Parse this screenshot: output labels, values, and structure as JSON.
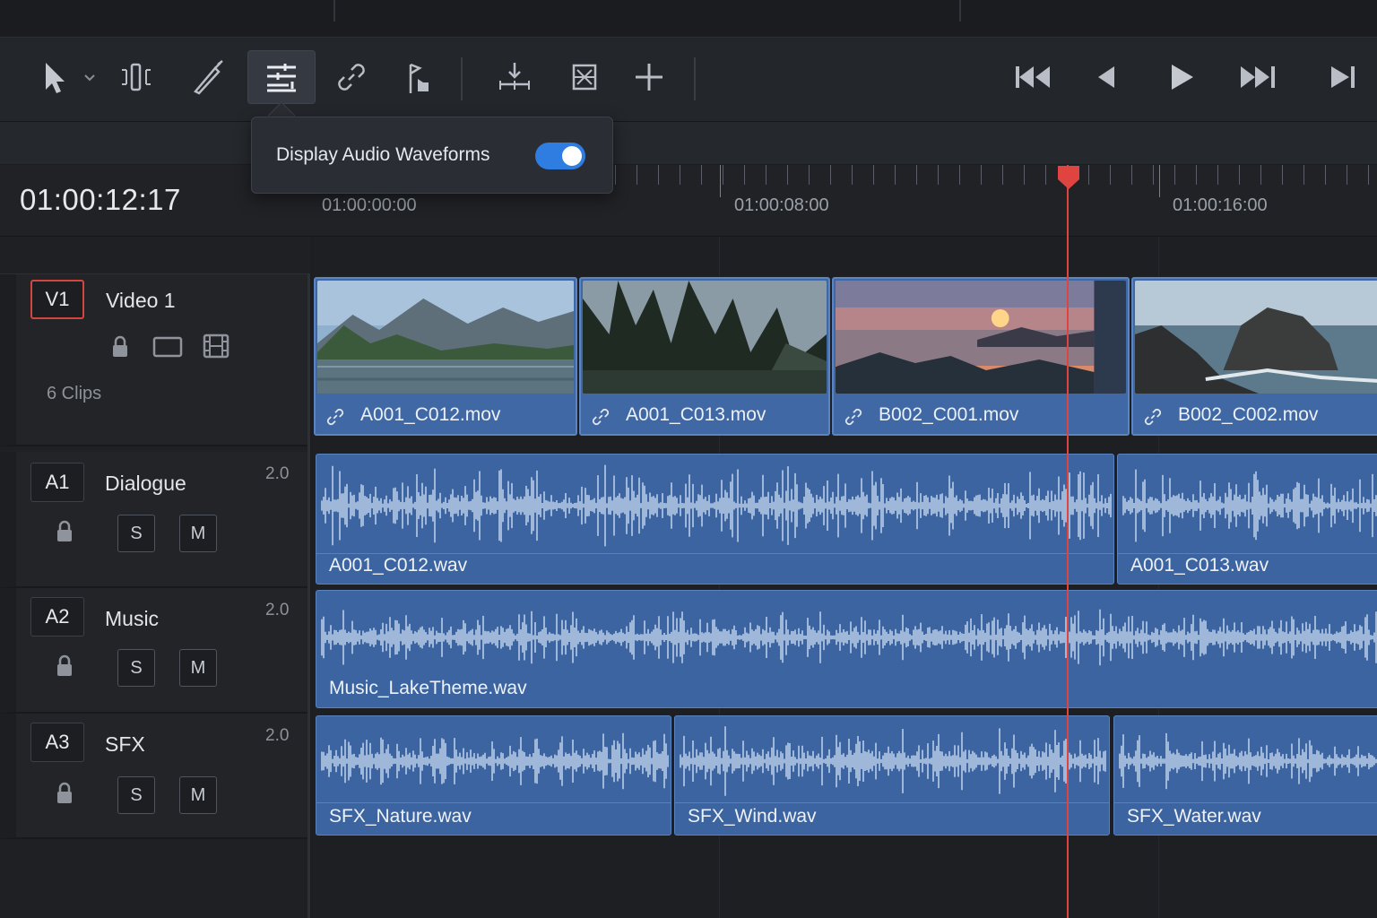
{
  "toolbar": {
    "tools": [
      {
        "name": "selection-tool",
        "icon": "pointer-icon"
      },
      {
        "name": "trim-tool",
        "icon": "trim-icon"
      },
      {
        "name": "blade-tool",
        "icon": "blade-icon"
      },
      {
        "name": "timeline-view-options",
        "icon": "view-options-icon",
        "active": true
      },
      {
        "name": "linked-selection",
        "icon": "link-icon"
      },
      {
        "name": "flag-tool",
        "icon": "flag-icon"
      },
      {
        "name": "snapping-tool",
        "icon": "snapping-icon"
      },
      {
        "name": "marker-tool",
        "icon": "marker-icon"
      },
      {
        "name": "add-tool",
        "icon": "plus-icon"
      }
    ],
    "transport": [
      "skip-to-start-icon",
      "step-back-icon",
      "play-icon",
      "skip-next-icon",
      "skip-to-end-icon"
    ]
  },
  "popover": {
    "label": "Display Audio Waveforms",
    "toggle_on": true,
    "accent": "#2f7de0"
  },
  "timecode": "01:00:12:17",
  "ruler": {
    "labels": [
      "01:00:00:00",
      "01:00:08:00",
      "01:00:16:00"
    ]
  },
  "playhead_color": "#e04440",
  "tracks": {
    "v1": {
      "badge": "V1",
      "name": "Video 1",
      "clips_count": "6 Clips"
    },
    "a1": {
      "badge": "A1",
      "name": "Dialogue",
      "channels": "2.0",
      "solo": "S",
      "mute": "M"
    },
    "a2": {
      "badge": "A2",
      "name": "Music",
      "channels": "2.0",
      "solo": "S",
      "mute": "M"
    },
    "a3": {
      "badge": "A3",
      "name": "SFX",
      "channels": "2.0",
      "solo": "S",
      "mute": "M"
    }
  },
  "video_clips": [
    "A001_C012.mov",
    "A001_C013.mov",
    "B002_C001.mov",
    "B002_C002.mov"
  ],
  "audio_clips": {
    "a1": [
      "A001_C012.wav",
      "A001_C013.wav"
    ],
    "a2": [
      "Music_LakeTheme.wav"
    ],
    "a3": [
      "SFX_Nature.wav",
      "SFX_Wind.wav",
      "SFX_Water.wav"
    ]
  },
  "clip_color": "#3f68a5"
}
